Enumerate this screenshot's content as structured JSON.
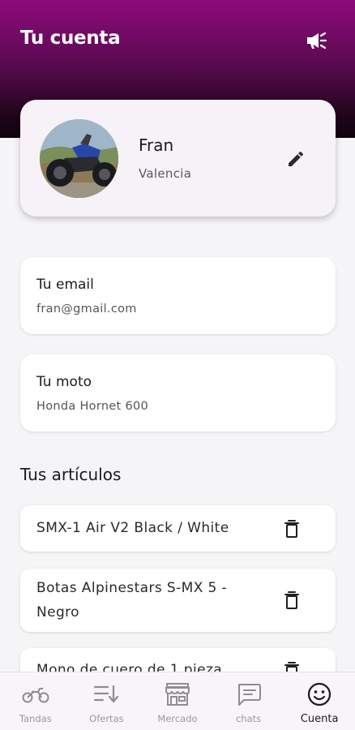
{
  "header": {
    "title": "Tu cuenta",
    "announce_icon": "megaphone-icon"
  },
  "profile": {
    "name": "Fran",
    "city": "Valencia",
    "edit_icon": "pencil-icon"
  },
  "email": {
    "label": "Tu email",
    "value": "fran@gmail.com"
  },
  "moto": {
    "label": "Tu moto",
    "value": "Honda Hornet 600"
  },
  "articles": {
    "title": "Tus artículos",
    "items": [
      {
        "name": "SMX-1 Air V2 Black / White"
      },
      {
        "name": "Botas Alpinestars S-MX 5 - Negro"
      },
      {
        "name": "Mono de cuero de 1 pieza"
      }
    ],
    "delete_icon": "trash-icon"
  },
  "nav": {
    "items": [
      {
        "label": "Tandas",
        "icon": "motorcycle-icon",
        "active": false
      },
      {
        "label": "Ofertas",
        "icon": "sort-list-icon",
        "active": false
      },
      {
        "label": "Mercado",
        "icon": "store-icon",
        "active": false
      },
      {
        "label": "chats",
        "icon": "chat-bubble-icon",
        "active": false
      },
      {
        "label": "Cuenta",
        "icon": "smiley-icon",
        "active": true
      }
    ]
  },
  "colors": {
    "header_gradient_top": "#8e0a7c",
    "header_gradient_bottom": "#120311",
    "background": "#f5f4f6",
    "profile_card": "#f7f2f8"
  }
}
